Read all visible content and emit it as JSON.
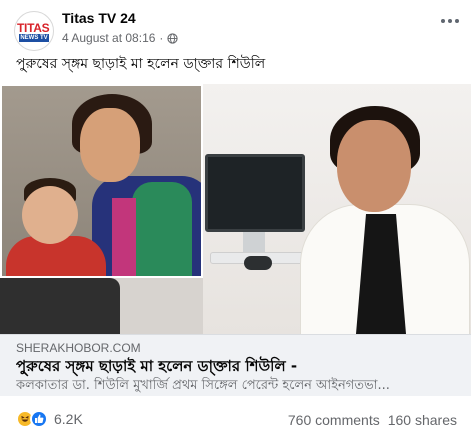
{
  "post": {
    "page_name": "Titas TV 24",
    "timestamp": "4 August at 08:16",
    "separator": "·",
    "privacy_icon": "globe-icon",
    "caption": "পু্রুষের স্ঙ্গম ছাড়াই মা হলেন ডা্ক্তার শিউলি",
    "avatar": {
      "brand_text": "TITAS",
      "sub_text": "NEWS TV",
      "brand_color": "#d8232a",
      "sub_color": "#1d4fa3"
    }
  },
  "link_preview": {
    "domain": "SHERAKHOBOR.COM",
    "title": "পু্রুষের স্ঙ্গম ছাড়াই মা হলেন ডা্ক্তার শিউলি -",
    "description": "কলকাতার ডা. শিউলি মুখার্জি প্রথম সিঙ্গেল পেরেন্ট হলেন আইনগতভা..."
  },
  "engagement": {
    "reaction_icons": [
      "haha-icon",
      "like-icon"
    ],
    "reaction_count": "6.2K",
    "comments": "760 comments",
    "shares": "160 shares"
  },
  "colors": {
    "accent": "#1877f2",
    "secondary_text": "#65676b",
    "link_bg": "#f0f2f5"
  }
}
